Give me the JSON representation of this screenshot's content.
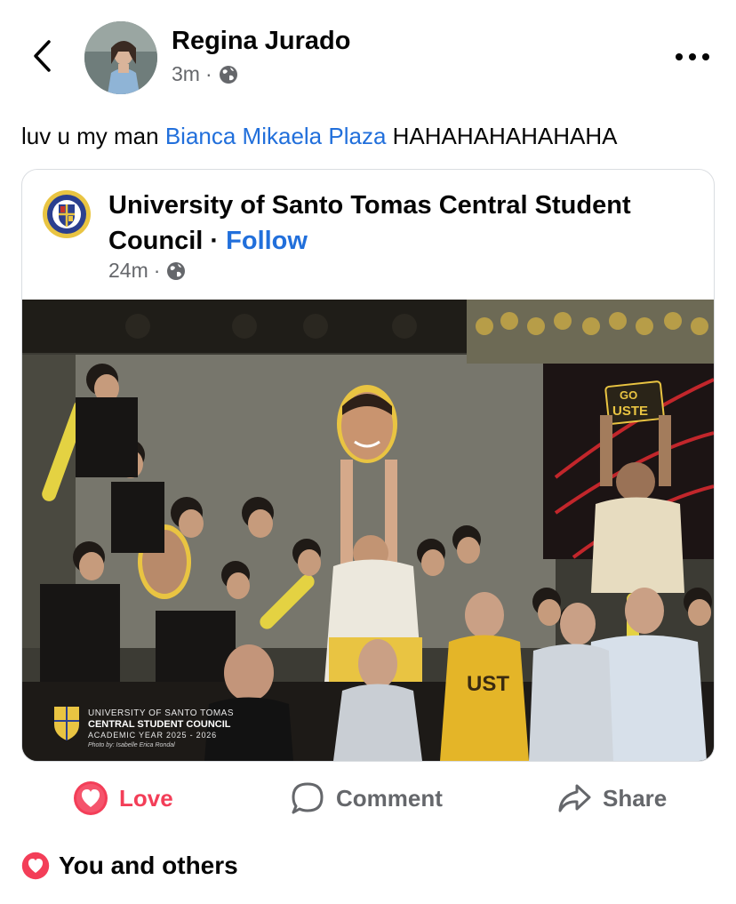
{
  "header": {
    "author_name": "Regina Jurado",
    "time": "3m",
    "separator": "·",
    "audience_icon": "globe-icon",
    "back_icon": "chevron-left-icon",
    "more_icon": "ellipsis-icon"
  },
  "post": {
    "text_before": "luv u my man ",
    "mention": "Bianca Mikaela Plaza",
    "text_after": " HAHAHAHAHAHAHA"
  },
  "shared": {
    "page_name": "University of Santo Tomas Central Student Council",
    "separator": "·",
    "follow_label": "Follow",
    "time": "24m",
    "photo_watermark": {
      "line1": "UNIVERSITY OF SANTO TOMAS",
      "line2": "CENTRAL STUDENT COUNCIL",
      "line3": "ACADEMIC YEAR 2025 - 2026",
      "line4": "Photo by: Isabelle Erica Rondal"
    },
    "sign_text_1": "GO",
    "sign_text_2": "USTE",
    "jersey_text": "UST"
  },
  "actions": {
    "love_label": "Love",
    "comment_label": "Comment",
    "share_label": "Share"
  },
  "reactions": {
    "summary": "You and others"
  },
  "colors": {
    "link_blue": "#216fdb",
    "love_red": "#f33e58",
    "secondary_text": "#65676b",
    "ust_yellow": "#e9c442"
  }
}
